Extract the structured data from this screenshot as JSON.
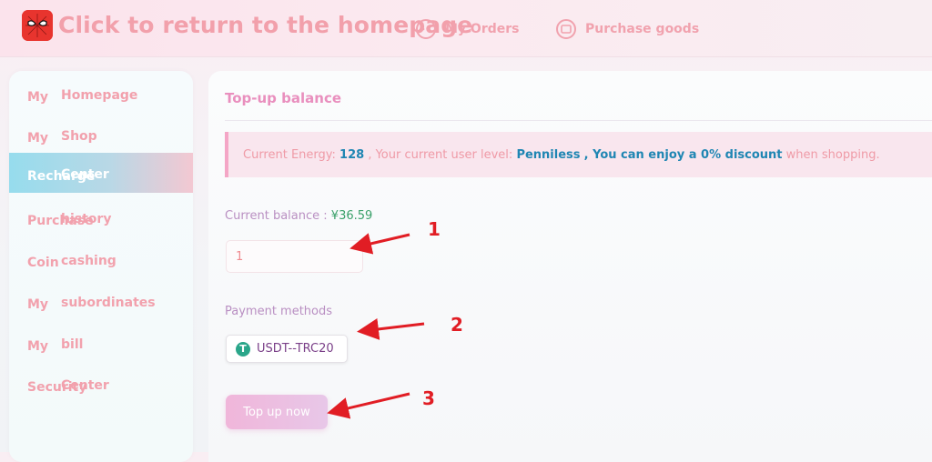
{
  "header": {
    "home_title": "Click to return to the homepage",
    "nav": [
      {
        "label": "My Orders",
        "icon": "chat-icon"
      },
      {
        "label": "Purchase goods",
        "icon": "shopping-icon"
      }
    ]
  },
  "sidebar": {
    "items": [
      {
        "a": "My",
        "b": "Homepage"
      },
      {
        "a": "My",
        "b": "Shop"
      },
      {
        "a": "Recharge",
        "b": "Center",
        "active": true
      },
      {
        "a": "Purchase",
        "b": "history"
      },
      {
        "a": "Coin",
        "b": "cashing"
      },
      {
        "a": "My",
        "b": "subordinates"
      },
      {
        "a": "My",
        "b": "bill"
      },
      {
        "a": "Security",
        "b": "Center"
      }
    ]
  },
  "main": {
    "title": "Top-up balance",
    "info": {
      "energy_prefix": "Current Energy:",
      "energy_value": "128",
      "level_prefix": ", Your current user level:",
      "level_value": "Penniless",
      "discount_text": ", You can enjoy a 0% discount",
      "suffix": "when shopping."
    },
    "balance_label": "Current balance :",
    "balance_value": "¥36.59",
    "amount_value": "1",
    "payment_label": "Payment methods",
    "payment_option": "USDT--TRC20",
    "topup_label": "Top up now"
  },
  "annotations": {
    "markers": [
      "1",
      "2",
      "3"
    ],
    "color": "#e11d24"
  },
  "colors": {
    "accent_pink": "#f2a1ad",
    "highlight_blue": "#1f86b3",
    "balance_green": "#3aa06a"
  }
}
